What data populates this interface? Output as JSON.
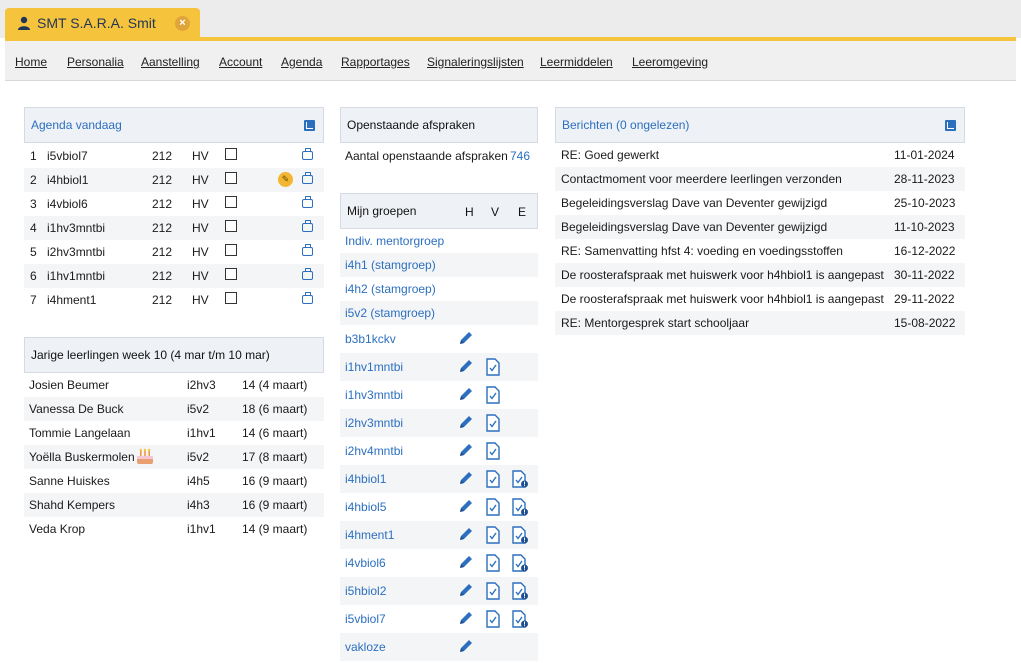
{
  "tab": {
    "title": "SMT  S.A.R.A. Smit",
    "close": "×"
  },
  "menu": [
    {
      "label": "Home"
    },
    {
      "label": "Personalia"
    },
    {
      "label": "Aanstelling"
    },
    {
      "label": "Account"
    },
    {
      "label": "Agenda"
    },
    {
      "label": "Rapportages"
    },
    {
      "label": "Signaleringslijsten"
    },
    {
      "label": "Leermiddelen"
    },
    {
      "label": "Leeromgeving"
    }
  ],
  "agenda": {
    "title": "Agenda vandaag",
    "rows": [
      {
        "nr": "1",
        "group": "i5vbiol7",
        "room": "212",
        "teacher": "HV",
        "pencil": false
      },
      {
        "nr": "2",
        "group": "i4hbiol1",
        "room": "212",
        "teacher": "HV",
        "pencil": true
      },
      {
        "nr": "3",
        "group": "i4vbiol6",
        "room": "212",
        "teacher": "HV",
        "pencil": false
      },
      {
        "nr": "4",
        "group": "i1hv3mntbi",
        "room": "212",
        "teacher": "HV",
        "pencil": false
      },
      {
        "nr": "5",
        "group": "i2hv3mntbi",
        "room": "212",
        "teacher": "HV",
        "pencil": false
      },
      {
        "nr": "6",
        "group": "i1hv1mntbi",
        "room": "212",
        "teacher": "HV",
        "pencil": false
      },
      {
        "nr": "7",
        "group": "i4hment1",
        "room": "212",
        "teacher": "HV",
        "pencil": false
      }
    ]
  },
  "birthdays": {
    "title": "Jarige leerlingen week 10   (4 mar t/m 10 mar)",
    "rows": [
      {
        "name": "Josien Beumer",
        "class": "i2hv3",
        "age": "14 (4 maart)",
        "cake": false
      },
      {
        "name": "Vanessa De Buck",
        "class": "i5v2",
        "age": "18 (6 maart)",
        "cake": false
      },
      {
        "name": "Tommie Langelaan",
        "class": "i1hv1",
        "age": "14 (6 maart)",
        "cake": false
      },
      {
        "name": "Yoëlla Buskermolen",
        "class": "i5v2",
        "age": "17 (8 maart)",
        "cake": true
      },
      {
        "name": "Sanne Huiskes",
        "class": "i4h5",
        "age": "16 (9 maart)",
        "cake": false
      },
      {
        "name": "Shahd Kempers",
        "class": "i4h3",
        "age": "16 (9 maart)",
        "cake": false
      },
      {
        "name": "Veda Krop",
        "class": "i1hv1",
        "age": "14 (9 maart)",
        "cake": false
      }
    ]
  },
  "appointments": {
    "title": "Openstaande afspraken",
    "label": "Aantal openstaande afspraken",
    "count": "746"
  },
  "groups": {
    "title": "Mijn groepen",
    "col_h": "H",
    "col_v": "V",
    "col_e": "E",
    "rows": [
      {
        "name": "Indiv. mentorgroep",
        "h": false,
        "v": false,
        "e": false
      },
      {
        "name": "i4h1 (stamgroep)",
        "h": false,
        "v": false,
        "e": false
      },
      {
        "name": "i4h2 (stamgroep)",
        "h": false,
        "v": false,
        "e": false
      },
      {
        "name": "i5v2 (stamgroep)",
        "h": false,
        "v": false,
        "e": false
      },
      {
        "name": "b3b1kckv",
        "h": true,
        "v": false,
        "e": false
      },
      {
        "name": "i1hv1mntbi",
        "h": true,
        "v": true,
        "e": false
      },
      {
        "name": "i1hv3mntbi",
        "h": true,
        "v": true,
        "e": false
      },
      {
        "name": "i2hv3mntbi",
        "h": true,
        "v": true,
        "e": false
      },
      {
        "name": "i2hv4mntbi",
        "h": true,
        "v": true,
        "e": false
      },
      {
        "name": "i4hbiol1",
        "h": true,
        "v": true,
        "e": true
      },
      {
        "name": "i4hbiol5",
        "h": true,
        "v": true,
        "e": true
      },
      {
        "name": "i4hment1",
        "h": true,
        "v": true,
        "e": true
      },
      {
        "name": "i4vbiol6",
        "h": true,
        "v": true,
        "e": true
      },
      {
        "name": "i5hbiol2",
        "h": true,
        "v": true,
        "e": true
      },
      {
        "name": "i5vbiol7",
        "h": true,
        "v": true,
        "e": true
      },
      {
        "name": "vakloze",
        "h": true,
        "v": false,
        "e": false
      }
    ]
  },
  "messages": {
    "title": "Berichten (0 ongelezen)",
    "rows": [
      {
        "subject": "RE: Goed gewerkt",
        "date": "11-01-2024"
      },
      {
        "subject": "Contactmoment voor meerdere leerlingen verzonden",
        "date": "28-11-2023"
      },
      {
        "subject": "Begeleidingsverslag Dave van Deventer gewijzigd",
        "date": "25-10-2023"
      },
      {
        "subject": "Begeleidingsverslag Dave van Deventer gewijzigd",
        "date": "11-10-2023"
      },
      {
        "subject": "RE: Samenvatting hfst 4: voeding en voedingsstoffen",
        "date": "16-12-2022"
      },
      {
        "subject": "De roosterafspraak met huiswerk voor h4hbiol1 is aangepast",
        "date": "30-11-2022"
      },
      {
        "subject": "De roosterafspraak met huiswerk voor h4hbiol1 is aangepast",
        "date": "29-11-2022"
      },
      {
        "subject": "RE: Mentorgesprek start schooljaar",
        "date": "15-08-2022"
      }
    ]
  },
  "colors": {
    "accent": "#f6c33c",
    "link": "#2c6fbf"
  }
}
